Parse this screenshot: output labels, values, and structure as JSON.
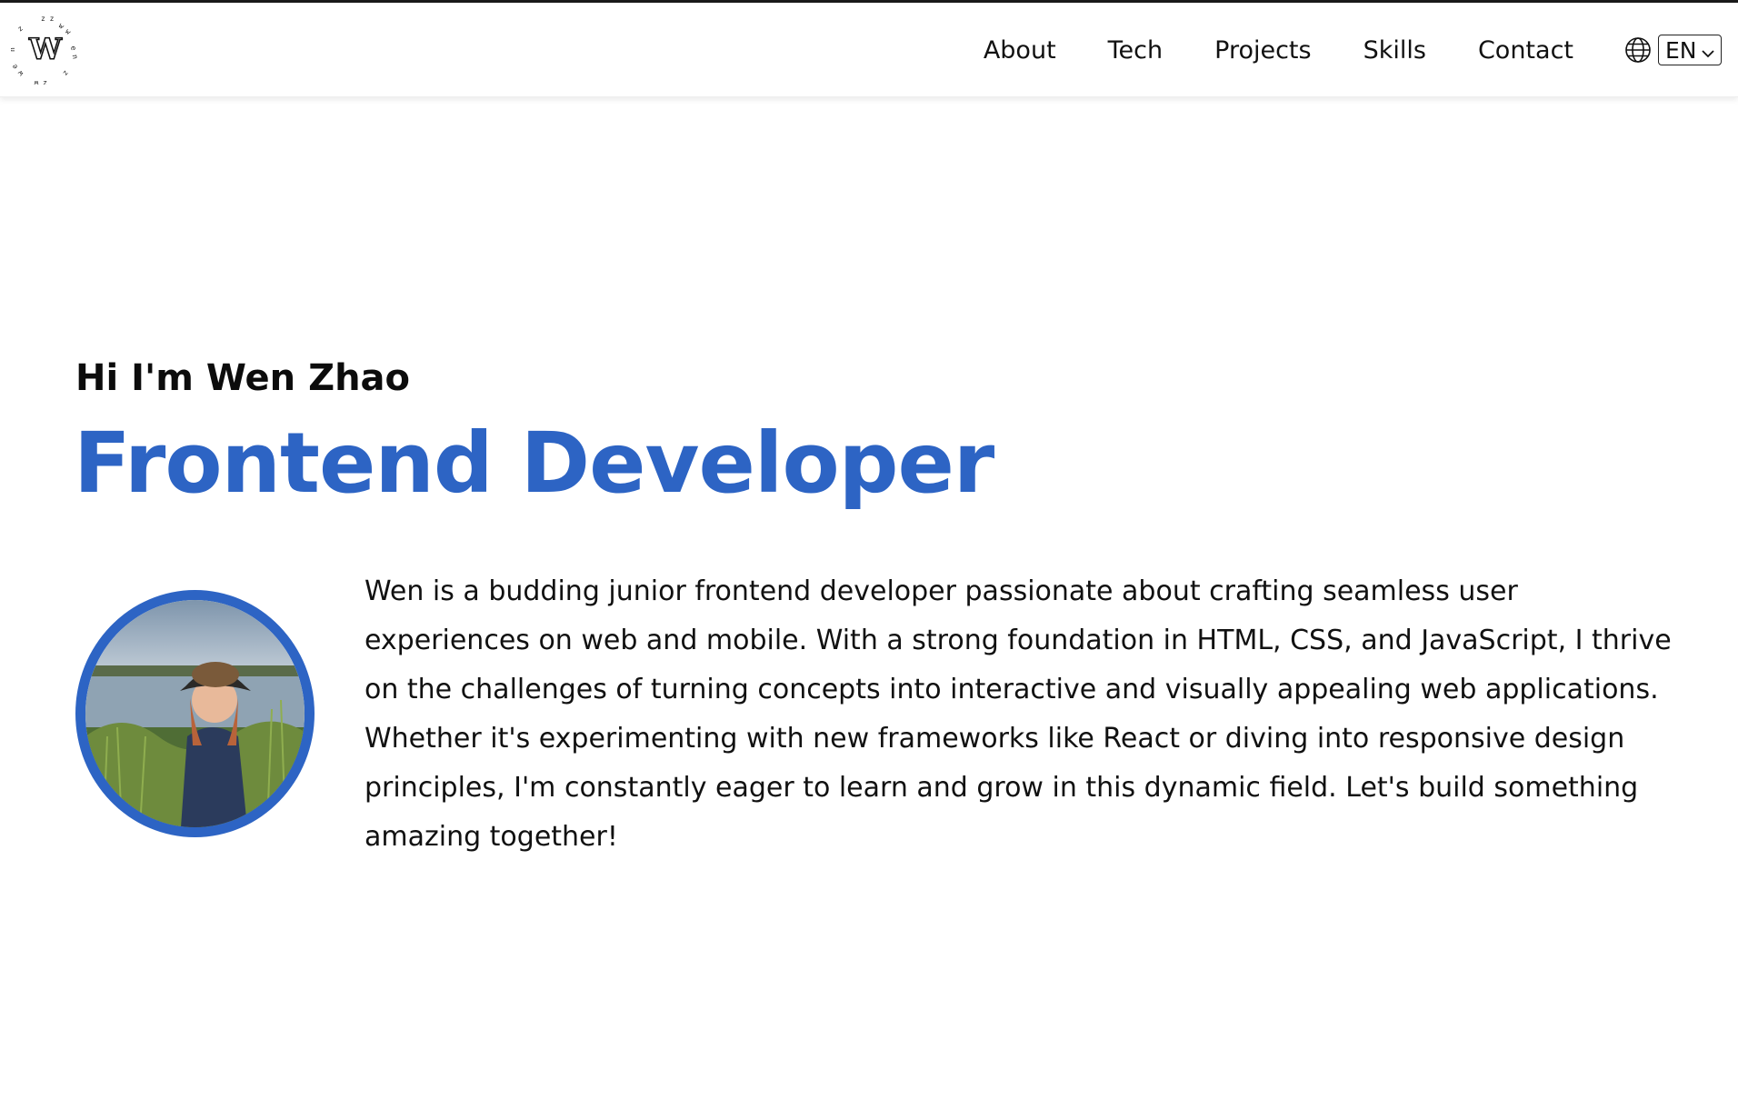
{
  "header": {
    "logo_text": "W",
    "logo_ring_text": "wenzhaowenzhao",
    "nav": [
      "About",
      "Tech",
      "Projects",
      "Skills",
      "Contact"
    ],
    "language": "EN"
  },
  "hero": {
    "greeting": "Hi I'm Wen Zhao",
    "role": "Frontend Developer",
    "bio": "Wen is a budding junior frontend developer passionate about crafting seamless user experiences on web and mobile. With a strong foundation in HTML, CSS, and JavaScript, I thrive on the challenges of turning concepts into interactive and visually appealing web applications. Whether it's experimenting with new frameworks like React or diving into responsive design principles, I'm constantly eager to learn and grow in this dynamic field. Let's build something amazing together!"
  },
  "colors": {
    "accent": "#2d64c4",
    "text": "#111111",
    "background": "#ffffff"
  },
  "icons": [
    "logo-icon",
    "globe-icon",
    "chevron-down-icon"
  ]
}
